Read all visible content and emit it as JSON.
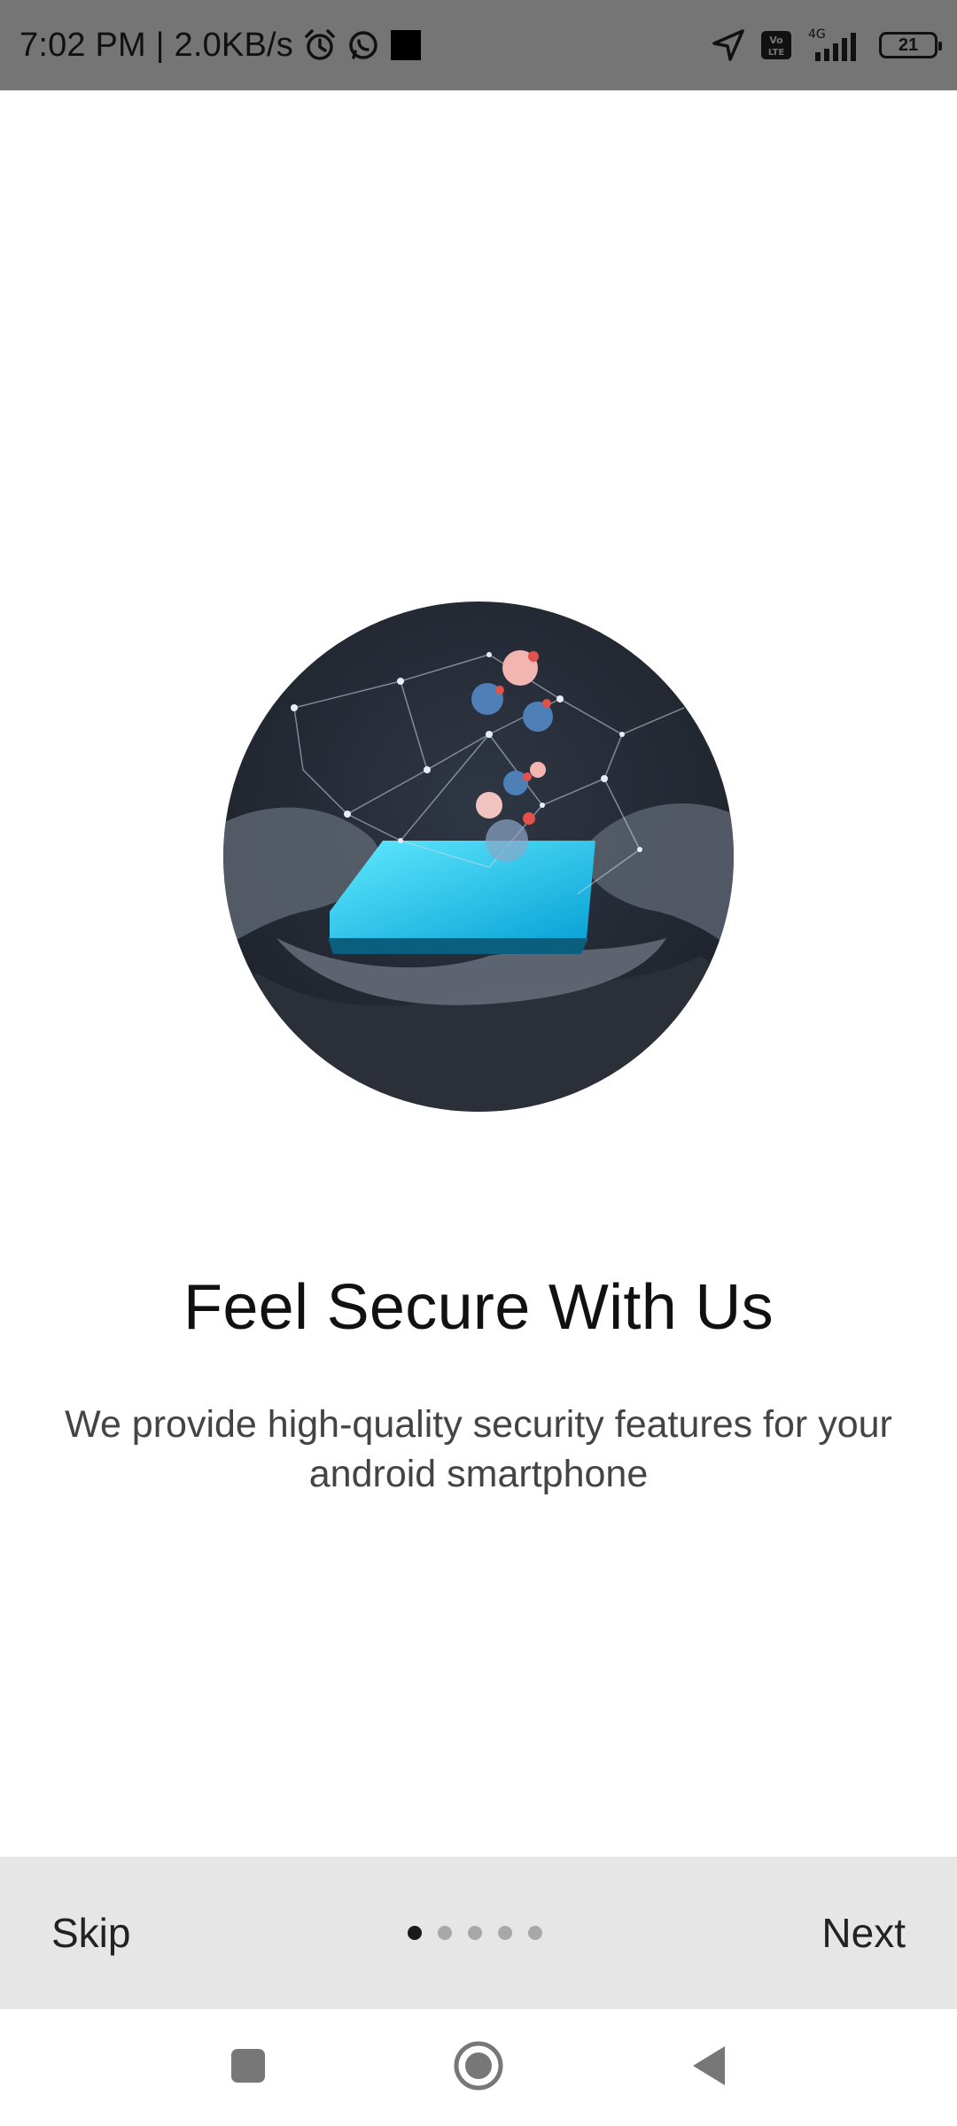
{
  "status_bar": {
    "time_speed": "7:02 PM | 2.0KB/s",
    "network": "4G",
    "volte": "Vo LTE",
    "battery": "21"
  },
  "icons": {
    "status": [
      "alarm-icon",
      "whatsapp-icon",
      "notification-square-icon",
      "location-arrow-icon",
      "volte-icon",
      "signal-icon",
      "battery-icon"
    ],
    "nav": [
      "recents-icon",
      "home-icon",
      "back-icon"
    ]
  },
  "onboarding": {
    "title": "Feel Secure With Us",
    "subtitle": "We provide high-quality security features for your android smartphone",
    "skip_label": "Skip",
    "next_label": "Next",
    "page_index": 1,
    "page_count": 5
  },
  "colors": {
    "status_bar_bg": "#757575",
    "bottom_bar_bg": "#e6e6e6",
    "dot_active": "#1a1a1a",
    "dot_inactive": "#a8a8a8"
  }
}
